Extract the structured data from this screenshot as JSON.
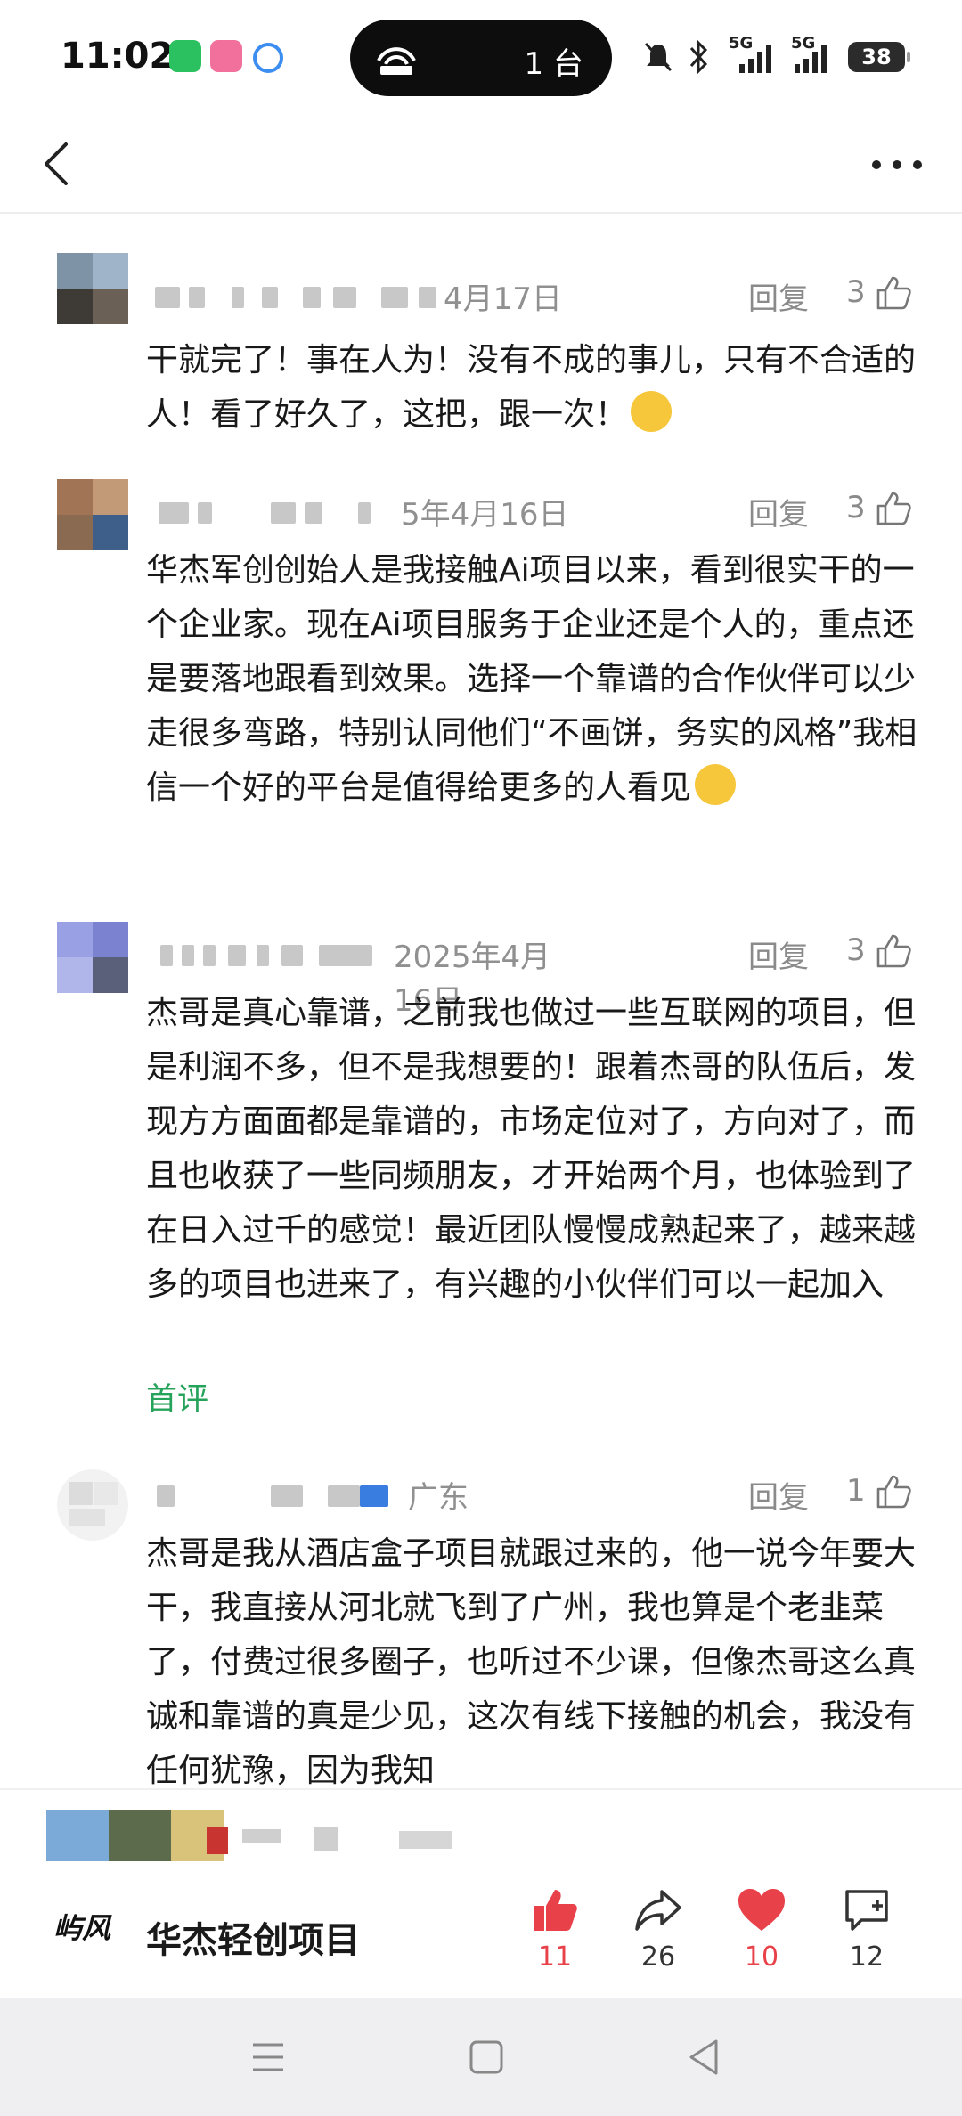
{
  "status_bar": {
    "time": "11:02",
    "hotspot_devices": "1 台",
    "battery": "38",
    "signal_1": "5G",
    "signal_2": "5G"
  },
  "comments": [
    {
      "date": "4月17日",
      "reply_label": "回复",
      "likes": "3",
      "text": "干就完了！事在人为！没有不成的事儿，只有不合适的人！看了好久了，这把，跟一次！"
    },
    {
      "date": "5年4月16日",
      "reply_label": "回复",
      "likes": "3",
      "text": "华杰军创创始人是我接触Ai项目以来，看到很实干的一个企业家。现在Ai项目服务于企业还是个人的，重点还是要落地跟看到效果。选择一个靠谱的合作伙伴可以少走很多弯路，特别认同他们“不画饼，务实的风格”我相信一个好的平台是值得给更多的人看见"
    },
    {
      "date": "2025年4月16日",
      "reply_label": "回复",
      "likes": "3",
      "text": "杰哥是真心靠谱，之前我也做过一些互联网的项目，但是利润不多，但不是我想要的！跟着杰哥的队伍后，发现方方面面都是靠谱的，市场定位对了，方向对了，而且也收获了一些同频朋友，才开始两个月，也体验到了在日入过千的感觉！最近团队慢慢成熟起来了，越来越多的项目也进来了，有兴趣的小伙伴们可以一起加入",
      "tag": "首评"
    },
    {
      "date": "广东",
      "reply_label": "回复",
      "likes": "1",
      "text": "杰哥是我从酒店盒子项目就跟过来的，他一说今年要大干，我直接从河北就飞到了广州，我也算是个老韭菜了，付费过很多圈子，也听过不少课，但像杰哥这么真诚和靠谱的真是少见，这次有线下接触的机会，我没有任何犹豫，因为我知"
    }
  ],
  "footer": {
    "account_logo": "屿风",
    "account_name": "华杰轻创项目",
    "actions": [
      {
        "icon": "thumbs-up-icon",
        "count": "11",
        "color": "#e8414a"
      },
      {
        "icon": "share-icon",
        "count": "26",
        "color": "#333333"
      },
      {
        "icon": "heart-icon",
        "count": "10",
        "color": "#e8414a"
      },
      {
        "icon": "comment-icon",
        "count": "12",
        "color": "#333333"
      }
    ]
  }
}
